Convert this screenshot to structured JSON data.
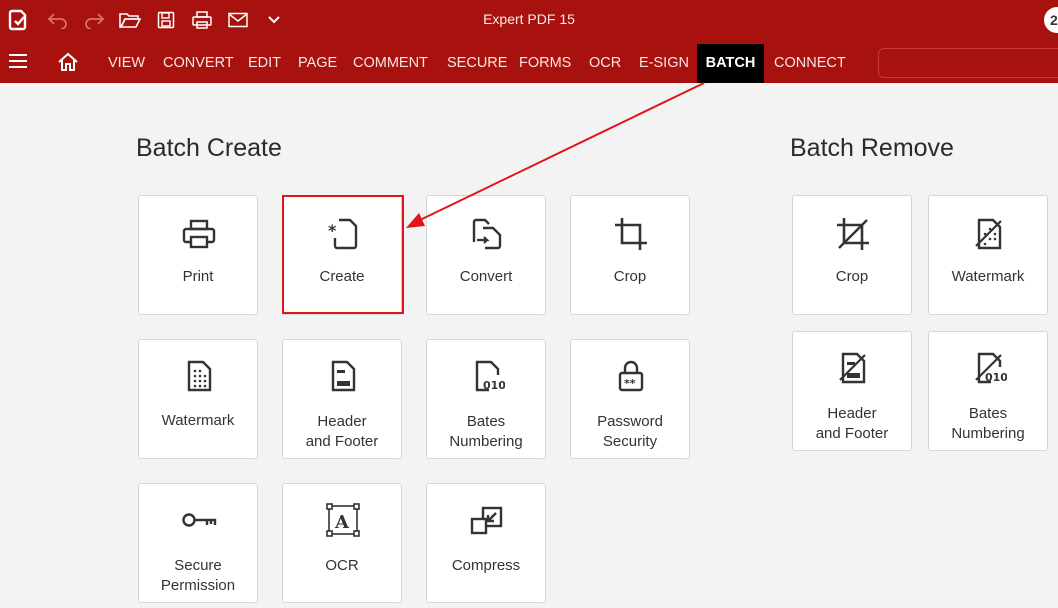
{
  "app": {
    "title": "Expert PDF 15",
    "avatar_letter": "2"
  },
  "titlebar_icons": [
    "app-logo-icon",
    "undo-icon",
    "redo-icon",
    "open-folder-icon",
    "save-icon",
    "print-icon",
    "email-icon",
    "chevron-down-icon"
  ],
  "menu": {
    "tabs": [
      "VIEW",
      "CONVERT",
      "EDIT",
      "PAGE",
      "COMMENT",
      "SECURE",
      "FORMS",
      "OCR",
      "E-SIGN",
      "BATCH",
      "CONNECT"
    ],
    "active_tab": "BATCH"
  },
  "batch_create": {
    "title": "Batch Create",
    "items": [
      {
        "label": "Print",
        "icon": "printer-icon"
      },
      {
        "label": "Create",
        "icon": "new-document-icon"
      },
      {
        "label": "Convert",
        "icon": "convert-icon"
      },
      {
        "label": "Crop",
        "icon": "crop-icon"
      },
      {
        "label": "Watermark",
        "icon": "watermark-icon"
      },
      {
        "label": "Header and Footer",
        "icon": "header-footer-icon"
      },
      {
        "label": "Bates Numbering",
        "icon": "bates-numbering-icon"
      },
      {
        "label": "Password Security",
        "icon": "lock-icon"
      },
      {
        "label": "Secure Permission",
        "icon": "key-icon"
      },
      {
        "label": "OCR",
        "icon": "ocr-icon"
      },
      {
        "label": "Compress",
        "icon": "compress-icon"
      }
    ]
  },
  "batch_remove": {
    "title": "Batch Remove",
    "items": [
      {
        "label": "Crop",
        "icon": "remove-crop-icon"
      },
      {
        "label": "Watermark",
        "icon": "remove-watermark-icon"
      },
      {
        "label": "Header and Footer",
        "icon": "remove-header-footer-icon"
      },
      {
        "label": "Bates Numbering",
        "icon": "remove-bates-icon"
      }
    ]
  },
  "colors": {
    "brand_red": "#a8120e",
    "highlight_red": "#e0141a",
    "active_tab_bg": "#000000"
  }
}
